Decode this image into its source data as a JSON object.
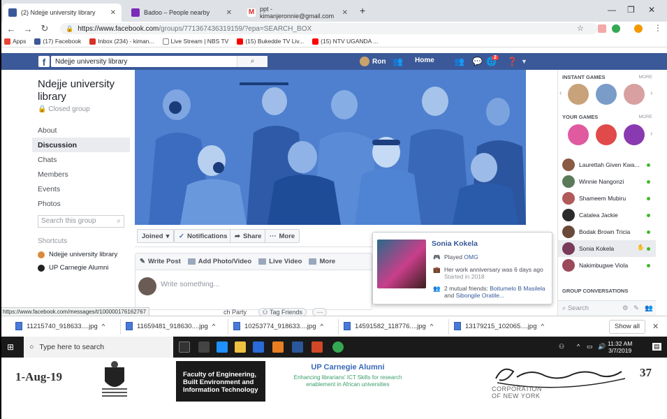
{
  "browser": {
    "tabs": [
      {
        "label": "(2) Ndejje university library",
        "favicon_color": "#3b5998"
      },
      {
        "label": "Badoo – People nearby",
        "favicon_color": "#7b2bb8"
      },
      {
        "label": "ppt - kimanjeronnie@gmail.com",
        "favicon_color": "#d93025"
      }
    ],
    "url_host": "https://www.facebook.com",
    "url_rest": "/groups/771367436319159/?epa=SEARCH_BOX",
    "bookmarks": [
      {
        "label": "Apps",
        "icon": "grid-icon",
        "color": "#ea4335"
      },
      {
        "label": "(17) Facebook",
        "icon": "facebook-icon",
        "color": "#3b5998"
      },
      {
        "label": "Inbox (234) - kiman...",
        "icon": "gmail-icon",
        "color": "#d93025"
      },
      {
        "label": "Live Stream | NBS TV",
        "icon": "page-icon",
        "color": "#888888"
      },
      {
        "label": "(15) Bukedde TV Liv...",
        "icon": "youtube-icon",
        "color": "#ff0000"
      },
      {
        "label": "(15) NTV UGANDA ...",
        "icon": "youtube-icon",
        "color": "#ff0000"
      }
    ]
  },
  "fb": {
    "search_value": "Ndejje university library",
    "user_name": "Ron",
    "home_label": "Home",
    "notifications_count": "2"
  },
  "group": {
    "name": "Ndejje university library",
    "privacy": "Closed group",
    "nav": [
      "About",
      "Discussion",
      "Chats",
      "Members",
      "Events",
      "Photos"
    ],
    "active_nav": "Discussion",
    "search_placeholder": "Search this group",
    "shortcuts_heading": "Shortcuts",
    "shortcuts": [
      "Ndejje university library",
      "UP Carnegie Alumni"
    ]
  },
  "actions": {
    "joined": "Joined",
    "notifications": "Notifications",
    "share": "Share",
    "more": "More"
  },
  "composer": {
    "tabs": [
      "Write Post",
      "Add Photo/Video",
      "Live Video",
      "More"
    ],
    "placeholder": "Write something...",
    "peek": "ch Party",
    "tag_friends": "Tag Friends"
  },
  "status_url": "https://www.facebook.com/messages/t/100000176162767",
  "hovercard": {
    "name": "Sonia Kokela",
    "played_prefix": "Played",
    "played_game": "OMG",
    "anniversary": "Her work anniversary was 6 days ago",
    "started": "Started in 2018",
    "mutual_prefix": "2 mutual friends:",
    "mutual_friend_1": "Boitumelo B Masilela",
    "mutual_and": "and",
    "mutual_friend_2": "Sibongile Oratile..."
  },
  "sidebar": {
    "instant_games": "INSTANT GAMES",
    "your_games": "YOUR GAMES",
    "more": "MORE",
    "contacts": [
      {
        "name": "Laurettah Given Kwa...",
        "color": "#8a5a44"
      },
      {
        "name": "Winnie Nangonzi",
        "color": "#5a7a5a"
      },
      {
        "name": "Shameem Mubiru",
        "color": "#b05a5a"
      },
      {
        "name": "Catalea Jackie",
        "color": "#2a2a2a"
      },
      {
        "name": "Bodak Brown Tricia",
        "color": "#6a4a3a"
      },
      {
        "name": "Sonia Kokela",
        "color": "#7a3a5a"
      },
      {
        "name": "Nakimbugwe Viola",
        "color": "#9a4a5a"
      }
    ],
    "group_conversations": "GROUP CONVERSATIONS",
    "search_placeholder": "Search"
  },
  "downloads": {
    "files": [
      "11215740_918633....jpg",
      "11659481_918630....jpg",
      "10253774_918633....jpg",
      "14591582_118776....jpg",
      "13179215_102065....jpg"
    ],
    "show_all": "Show all"
  },
  "taskbar": {
    "search_placeholder": "Type here to search",
    "time": "11:32 AM",
    "date": "3/7/2019"
  },
  "slide": {
    "date": "1-Aug-19",
    "faculty_line1": "Faculty of Engineering,",
    "faculty_line2": "Built Environment and",
    "faculty_line3": "Information Technology",
    "alumni_title": "UP Carnegie Alumni",
    "alumni_sub": "Enhancing librarians' ICT Skills for research enablement in African universities",
    "carnegie_line1": "CORPORATION",
    "carnegie_line2": "OF NEW YORK",
    "slide_number": "37"
  }
}
